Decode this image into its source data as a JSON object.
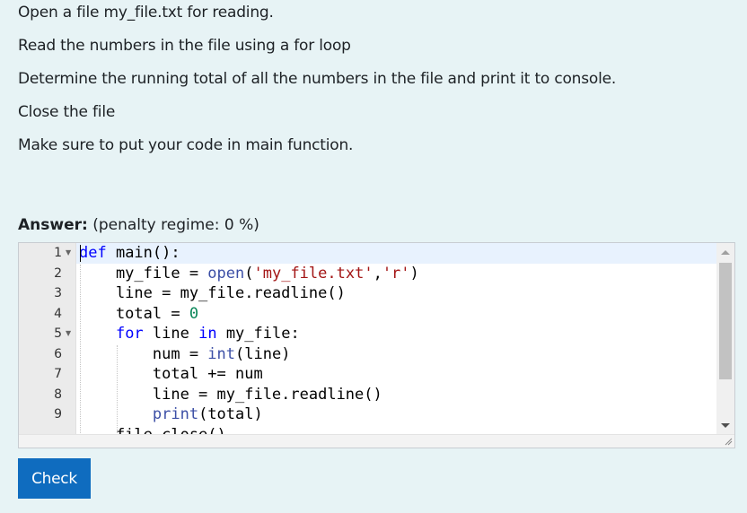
{
  "instructions": [
    "Open a file my_file.txt for reading.",
    "Read the numbers in the file using a for loop",
    "Determine the running total of all the numbers in the file and print it to console.",
    "Close the file",
    "Make sure to put your code in main function."
  ],
  "answer": {
    "label": "Answer:",
    "penalty": "(penalty regime: 0 %)"
  },
  "editor": {
    "line_numbers": [
      "1",
      "2",
      "3",
      "4",
      "5",
      "6",
      "7",
      "8",
      "9"
    ],
    "lines": [
      "def main():",
      "    my_file = open('my_file.txt','r')",
      "    line = my_file.readline()",
      "    total = 0",
      "    for line in my_file:",
      "        num = int(line)",
      "        total += num",
      "        line = my_file.readline()",
      "        print(total)",
      "    file.close()"
    ],
    "fold_lines": [
      1,
      5
    ]
  },
  "check_button": {
    "label": "Check",
    "color": "#0f6cbf"
  },
  "colors": {
    "background": "#e7f3f5",
    "keyword": "#0000ff",
    "string": "#a31515",
    "number": "#098658"
  }
}
